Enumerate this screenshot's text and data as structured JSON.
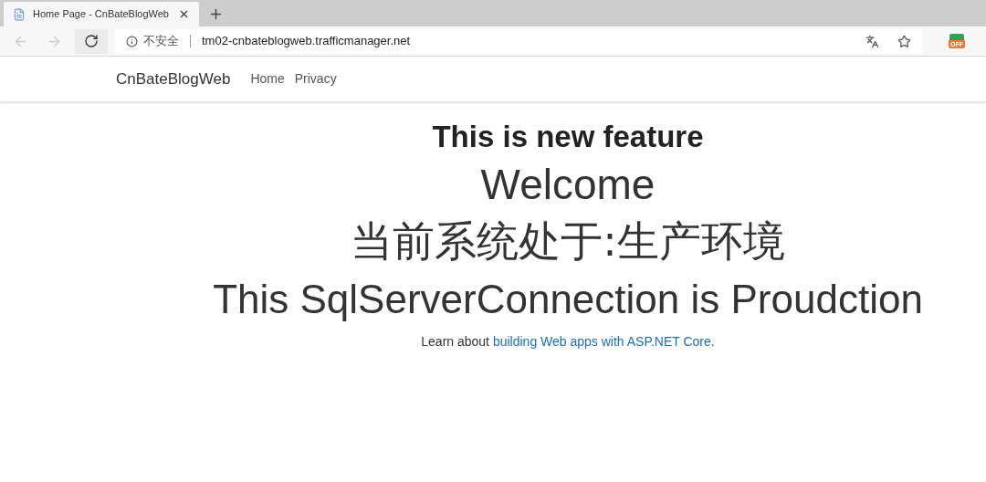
{
  "tab": {
    "title": "Home Page - CnBateBlogWeb",
    "selected": true
  },
  "address_bar": {
    "security": "不安全",
    "url": "tm02-cnbateblogweb.trafficmanager.net"
  },
  "extension_badge": "OFF",
  "navbar": {
    "brand": "CnBateBlogWeb",
    "links": [
      "Home",
      "Privacy"
    ]
  },
  "content": {
    "heading": "This is new feature",
    "welcome": "Welcome",
    "environment": "当前系统处于:生产环境",
    "connection": "This SqlServerConnection is Proudction",
    "learn": {
      "before": "Learn about ",
      "link": "building Web apps with ASP.NET Core",
      "after": "."
    }
  }
}
